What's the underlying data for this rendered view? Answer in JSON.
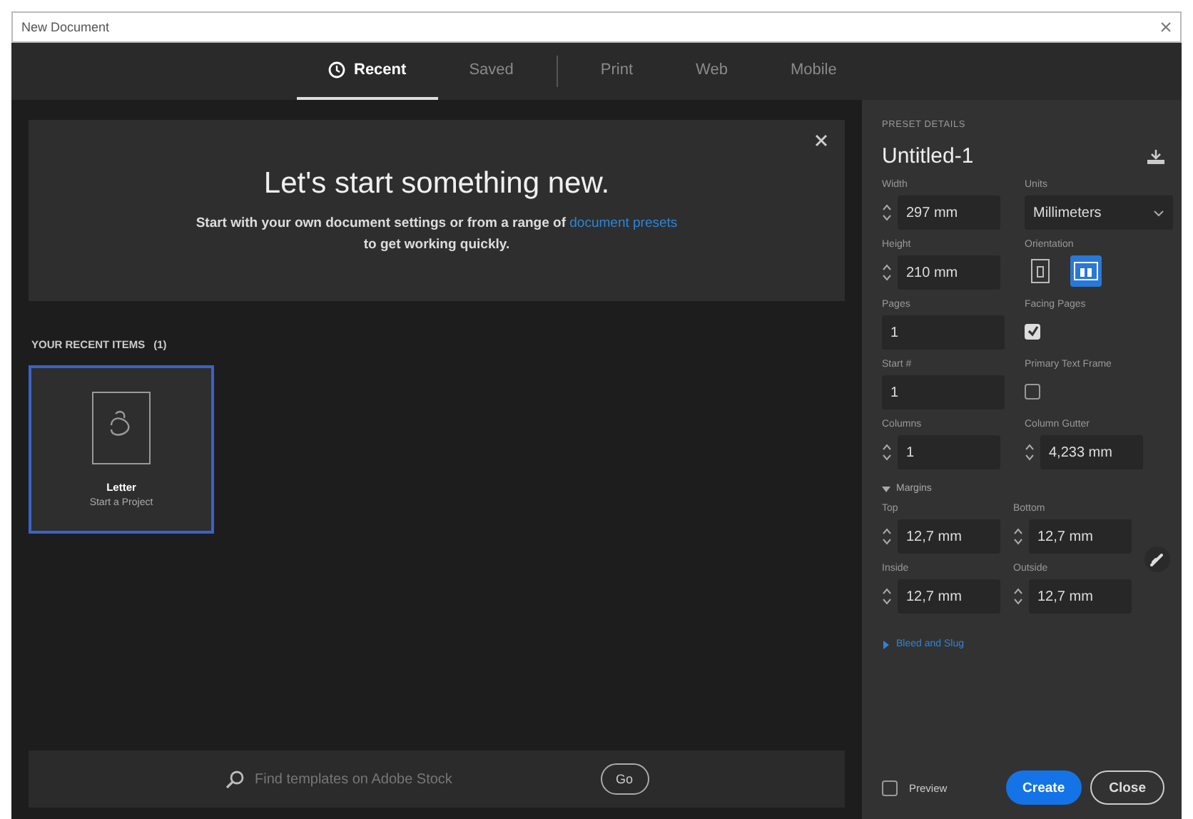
{
  "window": {
    "title": "New Document"
  },
  "tabs": [
    {
      "label": "Recent",
      "selected": true
    },
    {
      "label": "Saved",
      "selected": false
    },
    {
      "label": "Print",
      "selected": false
    },
    {
      "label": "Web",
      "selected": false
    },
    {
      "label": "Mobile",
      "selected": false
    }
  ],
  "banner": {
    "heading": "Let's start something new.",
    "text": "Start with your own document settings or from a range of",
    "link": "document presets",
    "text_end": "to get working quickly."
  },
  "recent": {
    "label": "YOUR RECENT ITEMS",
    "count": "(1)",
    "items": [
      {
        "name": "Letter",
        "detail": "Start a Project",
        "selected": true
      }
    ]
  },
  "search": {
    "placeholder": "Find templates on Adobe Stock",
    "button": "Go"
  },
  "preset": {
    "heading": "PRESET DETAILS",
    "name": "Untitled-1",
    "fields": [
      {
        "kind": "stepper",
        "label": "Width",
        "value": "297 mm"
      },
      {
        "kind": "select",
        "label": "Units",
        "value": "Millimeters"
      },
      {
        "kind": "stepper",
        "label": "Height",
        "value": "210 mm"
      },
      {
        "kind": "orientation",
        "label": "Orientation",
        "options": [
          {
            "kind": "portrait",
            "selected": false
          },
          {
            "kind": "landscape",
            "selected": true
          }
        ]
      },
      {
        "kind": "text",
        "label": "Pages",
        "value": "1"
      },
      {
        "kind": "checkbox",
        "label": "Facing Pages",
        "checked": true
      },
      {
        "kind": "text",
        "label": "Start #",
        "value": "1"
      },
      {
        "kind": "checkbox",
        "label": "Primary Text Frame",
        "checked": false
      },
      {
        "kind": "stepper",
        "label": "Columns",
        "value": "1"
      },
      {
        "kind": "stepper",
        "label": "Column Gutter",
        "value": "4,233 mm"
      }
    ],
    "margins": {
      "label": "Margins",
      "expanded": true,
      "fields": [
        {
          "kind": "stepper",
          "label": "Top",
          "value": "12,7 mm"
        },
        {
          "kind": "stepper",
          "label": "Bottom",
          "value": "12,7 mm"
        },
        {
          "kind": "stepper",
          "label": "Inside",
          "value": "12,7 mm"
        },
        {
          "kind": "stepper",
          "label": "Outside",
          "value": "12,7 mm"
        }
      ]
    },
    "bleed": {
      "label": "Bleed and Slug",
      "expanded": false
    },
    "preview": {
      "label": "Preview",
      "checked": false
    },
    "buttons": [
      {
        "label": "Create",
        "kind": "primary"
      },
      {
        "label": "Close",
        "kind": "secondary"
      }
    ]
  }
}
